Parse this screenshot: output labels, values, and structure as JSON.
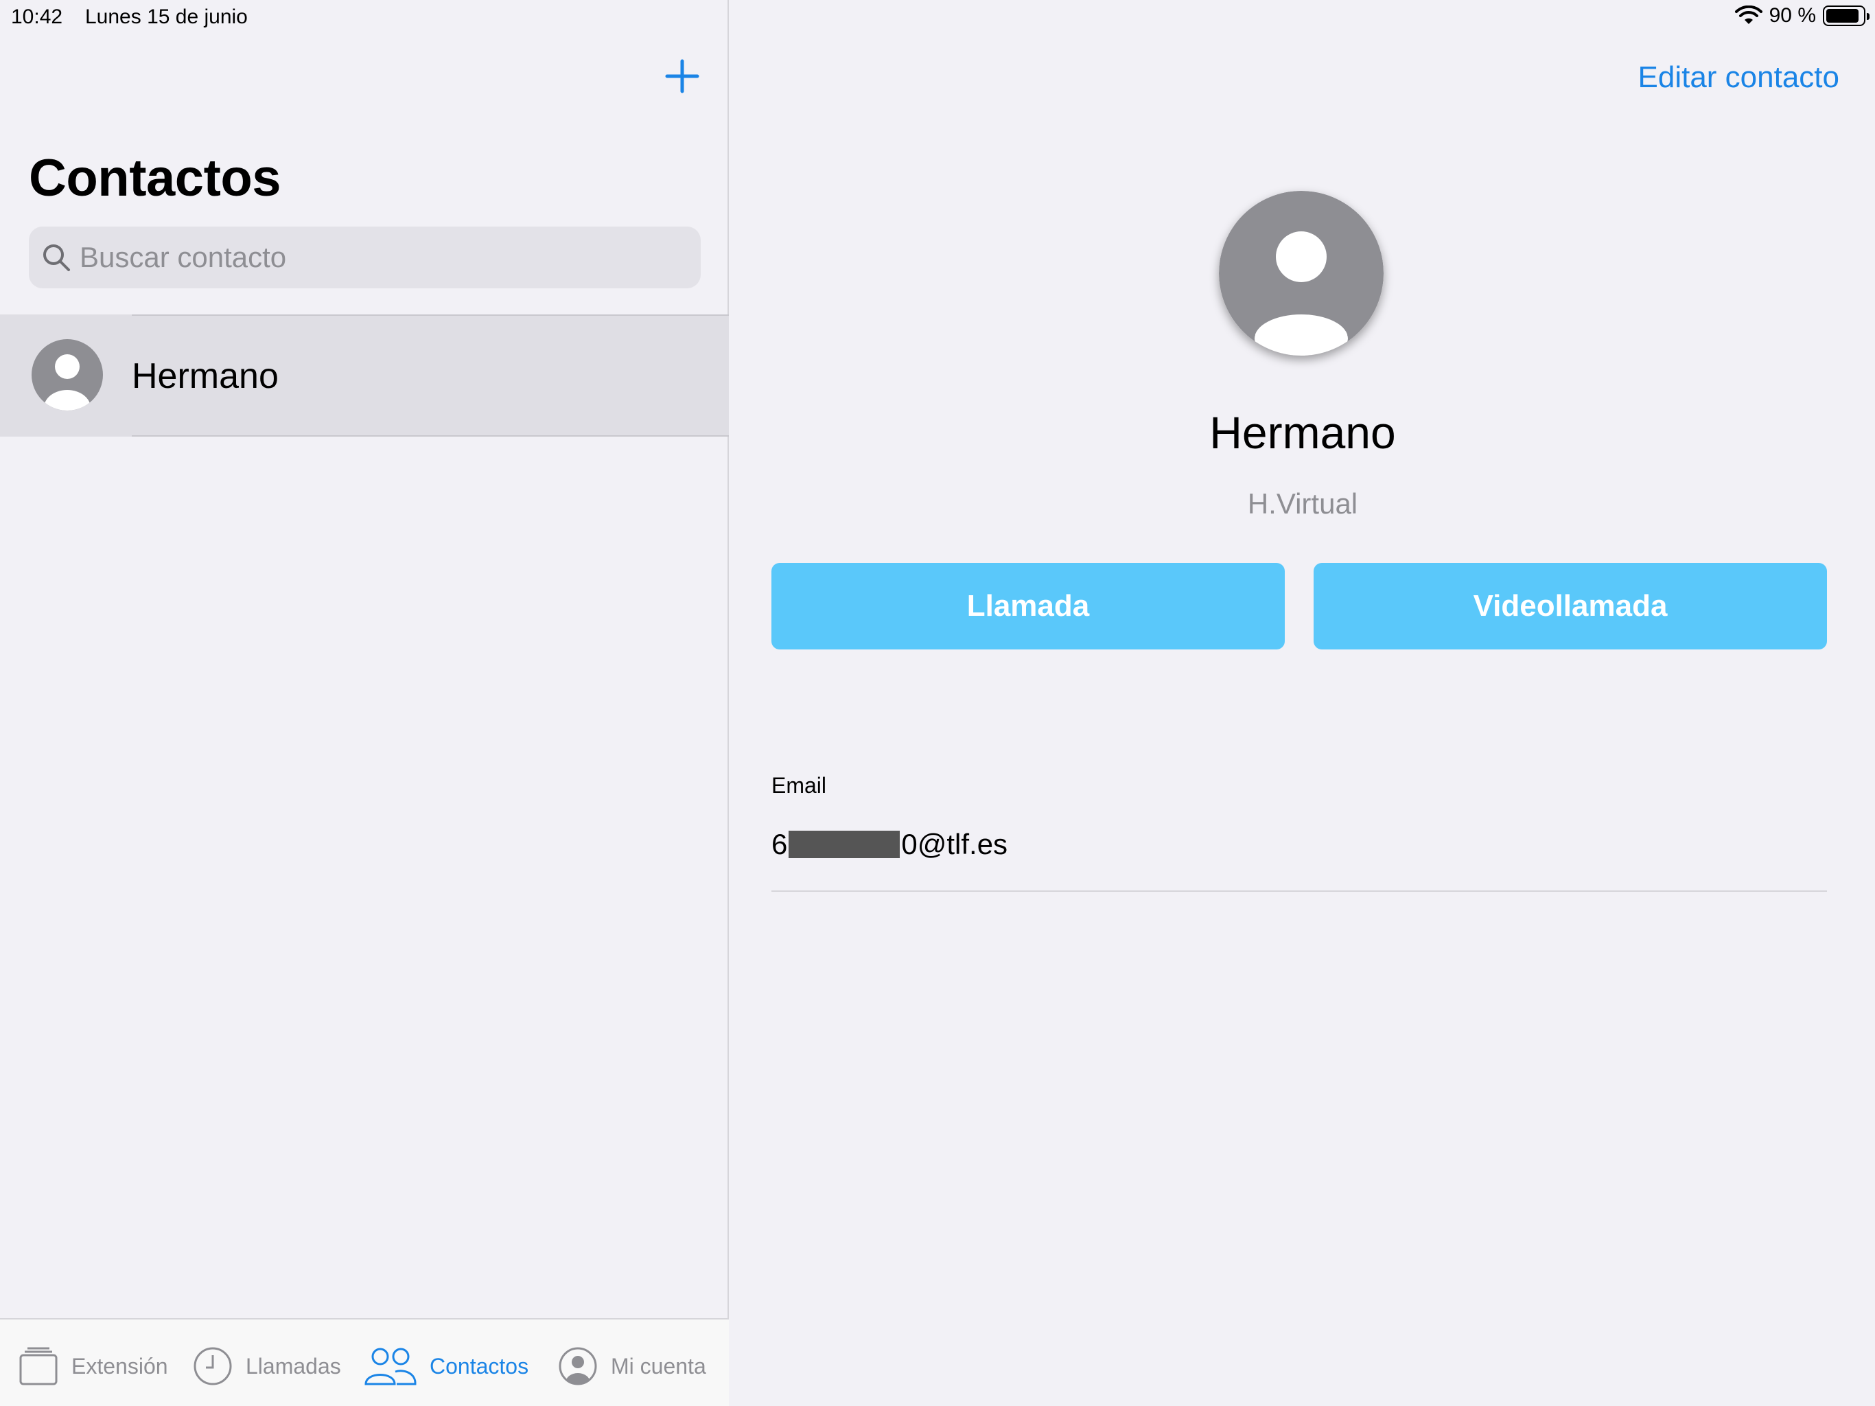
{
  "status_bar": {
    "time": "10:42",
    "date": "Lunes 15 de junio",
    "battery_percent": "90 %",
    "battery_level": 0.9
  },
  "contacts_list": {
    "title": "Contactos",
    "search_placeholder": "Buscar contacto",
    "items": [
      {
        "name": "Hermano"
      }
    ]
  },
  "tabbar": {
    "tabs": [
      {
        "label": "Extensión",
        "icon": "extension-icon",
        "active": false
      },
      {
        "label": "Llamadas",
        "icon": "clock-icon",
        "active": false
      },
      {
        "label": "Contactos",
        "icon": "people-icon",
        "active": true
      },
      {
        "label": "Mi cuenta",
        "icon": "account-icon",
        "active": false
      }
    ]
  },
  "contact_detail": {
    "edit_label": "Editar contacto",
    "name": "Hermano",
    "company": "H.Virtual",
    "call_label": "Llamada",
    "video_label": "Videollamada",
    "email_label": "Email",
    "email_prefix": "6",
    "email_suffix": "0@tlf.es"
  },
  "colors": {
    "accent": "#1a84e6",
    "button": "#5ac8fa",
    "background": "#f2f1f6",
    "selected_row": "#dfdee4"
  }
}
